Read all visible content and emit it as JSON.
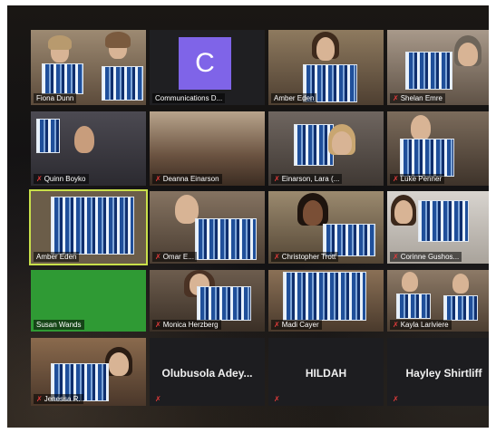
{
  "meeting": {
    "participants": [
      {
        "name": "Fiona Dunn",
        "muted": false
      },
      {
        "name": "Communications D...",
        "muted": false,
        "avatar_letter": "C",
        "avatar_color": "#7f64e8"
      },
      {
        "name": "Amber Eden",
        "muted": false
      },
      {
        "name": "Shelan Emre",
        "muted": true
      },
      {
        "name": "Quinn Boyko",
        "muted": true
      },
      {
        "name": "Deanna Einarson",
        "muted": true
      },
      {
        "name": "Einarson, Lara (...",
        "muted": true
      },
      {
        "name": "Luke Penner",
        "muted": true
      },
      {
        "name": "Amber Eden",
        "muted": false,
        "active_speaker": true
      },
      {
        "name": "Omar E...",
        "muted": true
      },
      {
        "name": "Christopher Trott",
        "muted": true
      },
      {
        "name": "Corinne Gushos...",
        "muted": true
      },
      {
        "name": "Susan Wands",
        "muted": false
      },
      {
        "name": "Monica Herzberg",
        "muted": true
      },
      {
        "name": "Madi Cayer",
        "muted": true
      },
      {
        "name": "Kayla Lariviere",
        "muted": true
      },
      {
        "name": "Jenessa R.",
        "muted": true
      },
      {
        "name": "Olubusola Adey...",
        "muted": true,
        "video_off": true
      },
      {
        "name": "HILDAH",
        "muted": true,
        "video_off": true
      },
      {
        "name": "Hayley Shirtliff",
        "muted": true,
        "video_off": true
      }
    ],
    "colors": {
      "active_speaker_outline": "#c9e04a",
      "muted_icon": "#e23b3b",
      "green_screen": "#2f9a34"
    }
  }
}
